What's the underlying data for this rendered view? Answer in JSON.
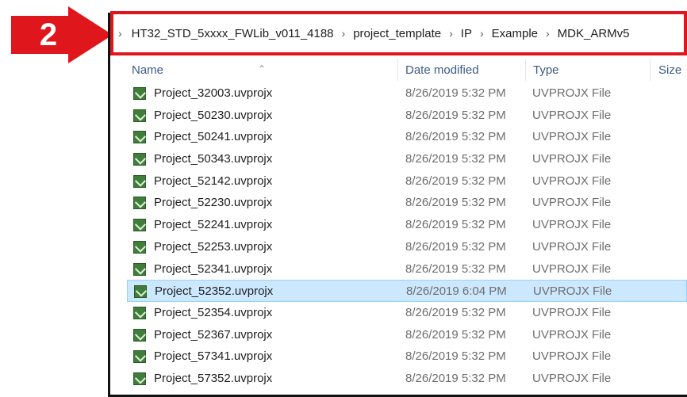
{
  "callout": {
    "step": "2"
  },
  "address": {
    "crumbs": [
      "HT32_STD_5xxxx_FWLib_v011_4188",
      "project_template",
      "IP",
      "Example",
      "MDK_ARMv5"
    ]
  },
  "columns": {
    "name": "Name",
    "date": "Date modified",
    "type": "Type",
    "size": "Size"
  },
  "files": [
    {
      "name": "Project_32003.uvprojx",
      "date": "8/26/2019 5:32 PM",
      "type": "UVPROJX File"
    },
    {
      "name": "Project_50230.uvprojx",
      "date": "8/26/2019 5:32 PM",
      "type": "UVPROJX File"
    },
    {
      "name": "Project_50241.uvprojx",
      "date": "8/26/2019 5:32 PM",
      "type": "UVPROJX File"
    },
    {
      "name": "Project_50343.uvprojx",
      "date": "8/26/2019 5:32 PM",
      "type": "UVPROJX File"
    },
    {
      "name": "Project_52142.uvprojx",
      "date": "8/26/2019 5:32 PM",
      "type": "UVPROJX File"
    },
    {
      "name": "Project_52230.uvprojx",
      "date": "8/26/2019 5:32 PM",
      "type": "UVPROJX File"
    },
    {
      "name": "Project_52241.uvprojx",
      "date": "8/26/2019 5:32 PM",
      "type": "UVPROJX File"
    },
    {
      "name": "Project_52253.uvprojx",
      "date": "8/26/2019 5:32 PM",
      "type": "UVPROJX File"
    },
    {
      "name": "Project_52341.uvprojx",
      "date": "8/26/2019 5:32 PM",
      "type": "UVPROJX File"
    },
    {
      "name": "Project_52352.uvprojx",
      "date": "8/26/2019 6:04 PM",
      "type": "UVPROJX File",
      "selected": true
    },
    {
      "name": "Project_52354.uvprojx",
      "date": "8/26/2019 5:32 PM",
      "type": "UVPROJX File"
    },
    {
      "name": "Project_52367.uvprojx",
      "date": "8/26/2019 5:32 PM",
      "type": "UVPROJX File"
    },
    {
      "name": "Project_57341.uvprojx",
      "date": "8/26/2019 5:32 PM",
      "type": "UVPROJX File"
    },
    {
      "name": "Project_57352.uvprojx",
      "date": "8/26/2019 5:32 PM",
      "type": "UVPROJX File"
    }
  ],
  "colors": {
    "callout": "#e0161d",
    "selection": "#cce8ff",
    "file_icon": "#3f7d3a"
  }
}
